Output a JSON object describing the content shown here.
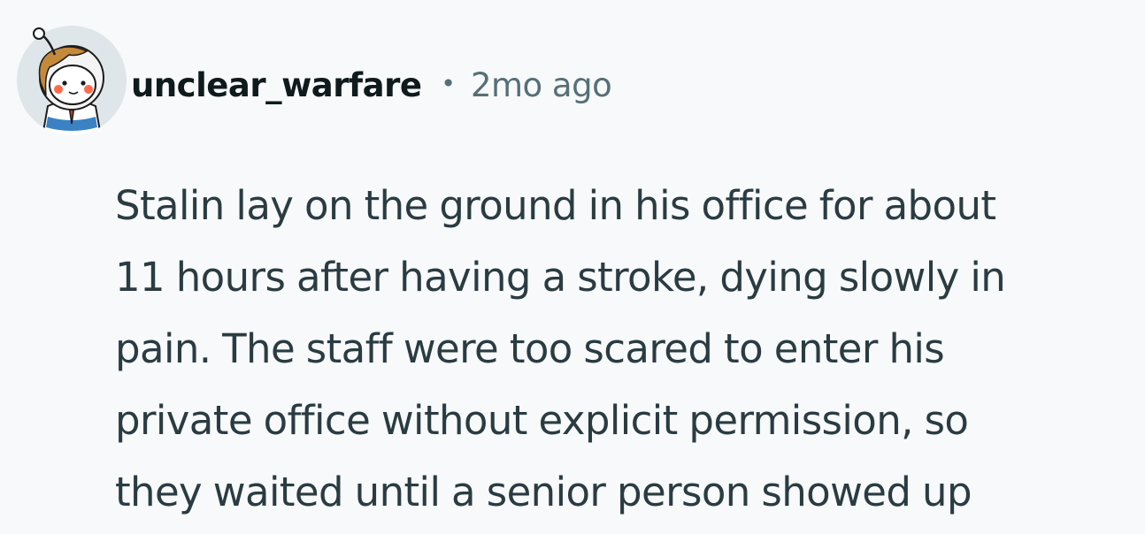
{
  "comment": {
    "username": "unclear_warfare",
    "separator": "•",
    "timestamp": "2mo ago",
    "avatar_icon": "snoo-avatar-icon",
    "body_lines": [
      "Stalin lay on the ground in his office for about",
      "11 hours after having a stroke, dying slowly in",
      "pain. The staff were too scared to enter his",
      "private office without explicit permission, so",
      "they waited until a senior person showed up"
    ]
  },
  "colors": {
    "background": "#f7f9fa",
    "username": "#0f1a1c",
    "meta": "#576f76",
    "body": "#2a3c42"
  }
}
